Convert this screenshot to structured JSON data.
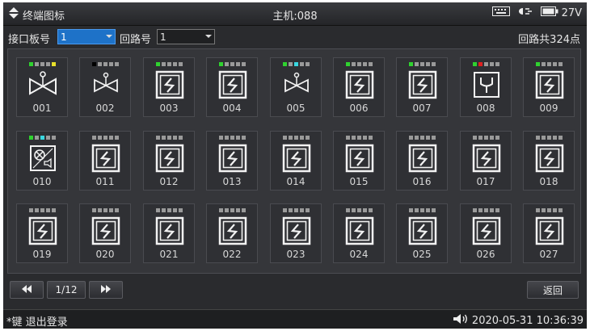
{
  "header": {
    "title": "终端图标",
    "host": "主机:088",
    "voltage": "27V",
    "icons": [
      "menu-updown-icon",
      "keyboard-icon",
      "ac-power-icon",
      "battery-icon"
    ]
  },
  "filters": {
    "board_label": "接口板号",
    "board_value": "1",
    "loop_label": "回路号",
    "loop_value": "1",
    "total_text": "回路共324点"
  },
  "tiles": [
    {
      "num": "001",
      "icon": "valve-large-icon",
      "leds": [
        "#2fd22f",
        "#9a9a9a",
        "#9a9a9a",
        "#9a9a9a",
        "#e8e02a"
      ]
    },
    {
      "num": "002",
      "icon": "valve-icon",
      "leds": [
        "#000000",
        "#9a9a9a",
        "#9a9a9a",
        "#9a9a9a",
        "#9a9a9a"
      ]
    },
    {
      "num": "003",
      "icon": "module-s-icon",
      "leds": [
        "#2fd22f",
        "#9a9a9a",
        "#9a9a9a",
        "#9a9a9a",
        "#9a9a9a"
      ]
    },
    {
      "num": "004",
      "icon": "module-s-icon",
      "leds": [
        "#2fd22f",
        "#9a9a9a",
        "#9a9a9a",
        "#9a9a9a",
        "#9a9a9a"
      ]
    },
    {
      "num": "005",
      "icon": "valve-icon",
      "leds": [
        "#2fd22f",
        "#9a9a9a",
        "#3ad7e0",
        "#9a9a9a",
        "#9a9a9a"
      ]
    },
    {
      "num": "006",
      "icon": "module-s-icon",
      "leds": [
        "#2fd22f",
        "#9a9a9a",
        "#9a9a9a",
        "#9a9a9a",
        "#9a9a9a"
      ]
    },
    {
      "num": "007",
      "icon": "module-s-icon",
      "leds": [
        "#2fd22f",
        "#9a9a9a",
        "#9a9a9a",
        "#9a9a9a",
        "#9a9a9a"
      ]
    },
    {
      "num": "008",
      "icon": "fork-y-icon",
      "leds": [
        "#2fd22f",
        "#e02020",
        "#9a9a9a",
        "#9a9a9a",
        "#9a9a9a"
      ]
    },
    {
      "num": "009",
      "icon": "module-s-icon",
      "leds": [
        "#2fd22f",
        "#9a9a9a",
        "#9a9a9a",
        "#9a9a9a",
        "#9a9a9a"
      ]
    },
    {
      "num": "010",
      "icon": "fan-control-icon",
      "leds": [
        "#2fd22f",
        "#9a9a9a",
        "#3ad7e0",
        "#9a9a9a",
        "#9a9a9a"
      ]
    },
    {
      "num": "011",
      "icon": "module-s-icon",
      "leds": [
        "#9a9a9a",
        "#9a9a9a",
        "#9a9a9a",
        "#9a9a9a",
        "#9a9a9a"
      ]
    },
    {
      "num": "012",
      "icon": "module-s-icon",
      "leds": [
        "#9a9a9a",
        "#9a9a9a",
        "#9a9a9a",
        "#9a9a9a",
        "#9a9a9a"
      ]
    },
    {
      "num": "013",
      "icon": "module-s-icon",
      "leds": [
        "#9a9a9a",
        "#9a9a9a",
        "#9a9a9a",
        "#9a9a9a",
        "#9a9a9a"
      ]
    },
    {
      "num": "014",
      "icon": "module-s-icon",
      "leds": [
        "#9a9a9a",
        "#9a9a9a",
        "#9a9a9a",
        "#9a9a9a",
        "#9a9a9a"
      ]
    },
    {
      "num": "015",
      "icon": "module-s-icon",
      "leds": [
        "#9a9a9a",
        "#9a9a9a",
        "#9a9a9a",
        "#9a9a9a",
        "#9a9a9a"
      ]
    },
    {
      "num": "016",
      "icon": "module-s-icon",
      "leds": [
        "#9a9a9a",
        "#9a9a9a",
        "#9a9a9a",
        "#9a9a9a",
        "#9a9a9a"
      ]
    },
    {
      "num": "017",
      "icon": "module-s-icon",
      "leds": [
        "#9a9a9a",
        "#9a9a9a",
        "#9a9a9a",
        "#9a9a9a",
        "#9a9a9a"
      ]
    },
    {
      "num": "018",
      "icon": "module-s-icon",
      "leds": [
        "#9a9a9a",
        "#9a9a9a",
        "#9a9a9a",
        "#9a9a9a",
        "#9a9a9a"
      ]
    },
    {
      "num": "019",
      "icon": "module-s-icon",
      "leds": [
        "#9a9a9a",
        "#9a9a9a",
        "#9a9a9a",
        "#9a9a9a",
        "#9a9a9a"
      ]
    },
    {
      "num": "020",
      "icon": "module-s-icon",
      "leds": [
        "#9a9a9a",
        "#9a9a9a",
        "#9a9a9a",
        "#9a9a9a",
        "#9a9a9a"
      ]
    },
    {
      "num": "021",
      "icon": "module-s-icon",
      "leds": [
        "#9a9a9a",
        "#9a9a9a",
        "#9a9a9a",
        "#9a9a9a",
        "#9a9a9a"
      ]
    },
    {
      "num": "022",
      "icon": "module-s-icon",
      "leds": [
        "#9a9a9a",
        "#9a9a9a",
        "#9a9a9a",
        "#9a9a9a",
        "#9a9a9a"
      ]
    },
    {
      "num": "023",
      "icon": "module-s-icon",
      "leds": [
        "#9a9a9a",
        "#9a9a9a",
        "#9a9a9a",
        "#9a9a9a",
        "#9a9a9a"
      ]
    },
    {
      "num": "024",
      "icon": "module-s-icon",
      "leds": [
        "#9a9a9a",
        "#9a9a9a",
        "#9a9a9a",
        "#9a9a9a",
        "#9a9a9a"
      ]
    },
    {
      "num": "025",
      "icon": "module-s-icon",
      "leds": [
        "#9a9a9a",
        "#9a9a9a",
        "#9a9a9a",
        "#9a9a9a",
        "#9a9a9a"
      ]
    },
    {
      "num": "026",
      "icon": "module-s-icon",
      "leds": [
        "#9a9a9a",
        "#9a9a9a",
        "#9a9a9a",
        "#9a9a9a",
        "#9a9a9a"
      ]
    },
    {
      "num": "027",
      "icon": "module-s-icon",
      "leds": [
        "#9a9a9a",
        "#9a9a9a",
        "#9a9a9a",
        "#9a9a9a",
        "#9a9a9a"
      ]
    }
  ],
  "pager": {
    "page_text": "1/12",
    "prev_icon": "double-left-arrow-icon",
    "next_icon": "double-right-arrow-icon",
    "back_label": "返回"
  },
  "footer": {
    "hint": "*键 退出登录",
    "datetime": "2020-05-31 10:36:39",
    "speaker_icon": "speaker-icon"
  }
}
